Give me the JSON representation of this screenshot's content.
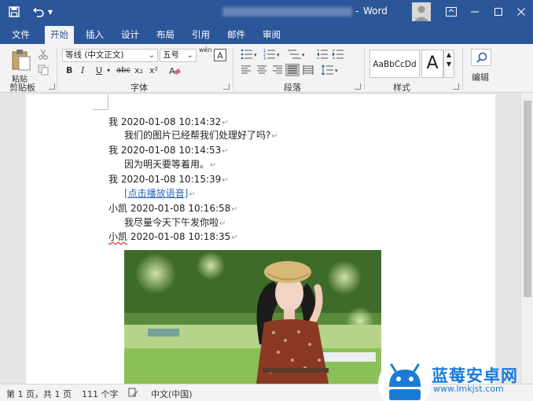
{
  "titlebar": {
    "app_name": "Word",
    "separator": "-"
  },
  "menu": {
    "tabs": [
      "文件",
      "开始",
      "插入",
      "设计",
      "布局",
      "引用",
      "邮件",
      "审阅"
    ],
    "active": "开始"
  },
  "ribbon": {
    "clipboard": {
      "paste": "粘贴",
      "label": "剪贴板"
    },
    "font": {
      "name": "等线 (中文正文)",
      "size": "五号",
      "phonetic": "wén",
      "bold": "B",
      "italic": "I",
      "underline": "U",
      "strike": "abc",
      "subscript": "x₂",
      "superscript": "x²",
      "label": "字体"
    },
    "paragraph": {
      "label": "段落"
    },
    "styles": {
      "preview": "AaBbCcDd",
      "preview2": "A",
      "label": "样式"
    },
    "editing": {
      "label": "编辑"
    }
  },
  "document": {
    "lines": [
      {
        "text": "我  2020-01-08 10:14:32",
        "indent": false
      },
      {
        "text": "我们的图片已经帮我们处理好了吗?",
        "indent": true
      },
      {
        "text": "我  2020-01-08 10:14:53",
        "indent": false
      },
      {
        "text": "因为明天要等着用。",
        "indent": true
      },
      {
        "text": "我  2020-01-08 10:15:39",
        "indent": false
      },
      {
        "text": "[点击播放语音]",
        "indent": true,
        "link": true
      },
      {
        "text": "小凯  2020-01-08 10:16:58",
        "indent": false
      },
      {
        "text": "我尽量今天下午发你啦",
        "indent": true
      },
      {
        "text": "小凯  2020-01-08 10:18:35",
        "indent": false,
        "squiggle": "小凯"
      }
    ],
    "paragraph_mark": "↵"
  },
  "status": {
    "page": "第 1 页，共 1 页",
    "words": "111 个字",
    "language": "中文(中国)"
  },
  "watermark": {
    "name": "蓝莓安卓网",
    "url": "www.lmkjst.com"
  },
  "colors": {
    "brand": "#2b579a",
    "link": "#2e63b8",
    "watermark": "#1a7bd6"
  }
}
